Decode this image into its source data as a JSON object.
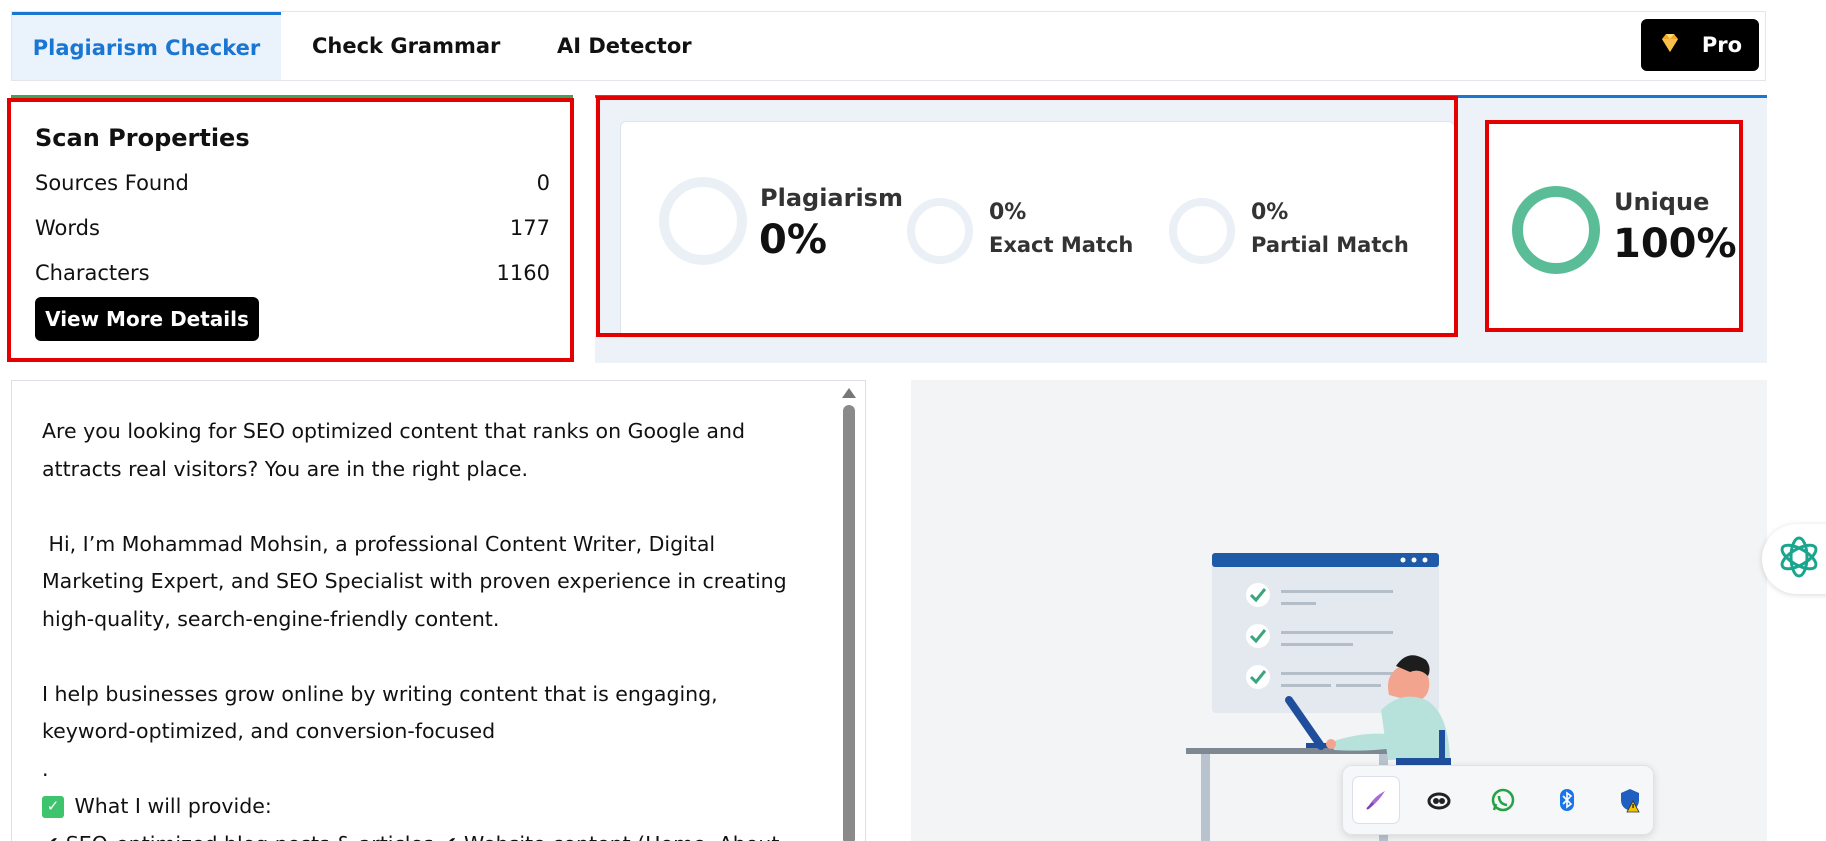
{
  "tabs": {
    "plagiarism": "Plagiarism Checker",
    "grammar": "Check Grammar",
    "ai_detector": "AI Detector",
    "pro": "Pro"
  },
  "scan": {
    "title": "Scan Properties",
    "sources_label": "Sources Found",
    "sources_value": "0",
    "words_label": "Words",
    "words_value": "177",
    "chars_label": "Characters",
    "chars_value": "1160",
    "button": "View More Details"
  },
  "results": {
    "plagiarism_title": "Plagiarism",
    "plagiarism_value": "0%",
    "exact_value": "0%",
    "exact_label": "Exact Match",
    "partial_value": "0%",
    "partial_label": "Partial Match",
    "unique_title": "Unique",
    "unique_value": "100%"
  },
  "editor": {
    "p1": "Are you looking for SEO optimized content that ranks on Google and attracts real visitors? You are in the right place.",
    "p2": " Hi, I’m Mohammad Mohsin, a professional Content Writer, Digital Marketing Expert, and SEO Specialist with proven experience in creating high-quality, search-engine-friendly content.",
    "p3": "I help businesses grow online by writing content that is engaging, keyword-optimized, and conversion-focused",
    "p4": ".",
    "p5": " What I will provide:",
    "p6": "✔ SEO-optimized blog posts & articles  ✔ Website content (Home, About"
  },
  "colors": {
    "accent": "#1976d2",
    "highlight_red": "#e30000",
    "unique_green": "#5bbd98",
    "ring_empty": "#ebf0f7"
  },
  "icons": {
    "pro": "diamond-icon",
    "fab": "openai-icon",
    "tray": [
      "pen-icon",
      "creative-cloud-icon",
      "whatsapp-icon",
      "bluetooth-icon",
      "security-shield-icon"
    ]
  }
}
